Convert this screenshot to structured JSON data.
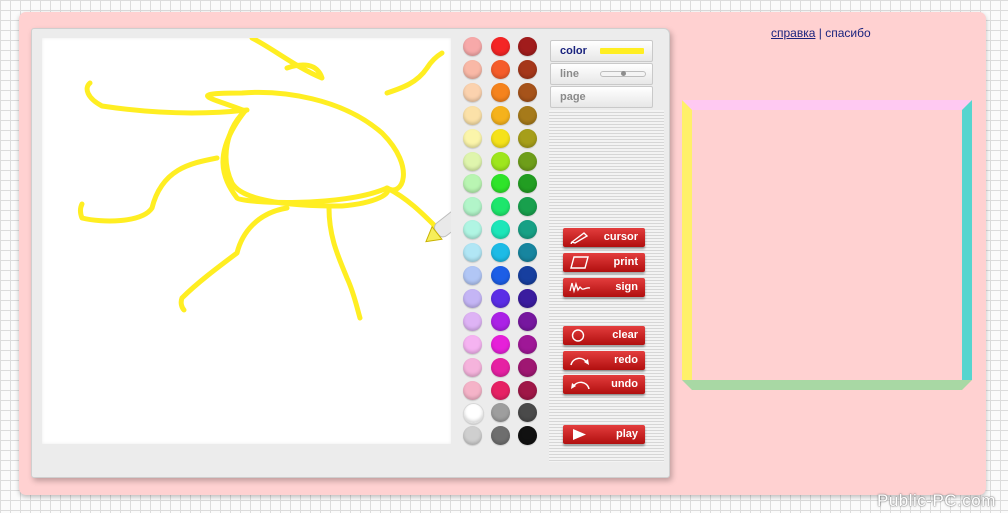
{
  "header_links": {
    "help": "справка",
    "separator": "|",
    "thanks": "спасибо"
  },
  "tool_tabs": {
    "color_label": "color",
    "line_label": "line",
    "page_label": "page",
    "current_color": "#ffee22"
  },
  "buttons": {
    "cursor": "cursor",
    "print": "print",
    "sign": "sign",
    "clear": "clear",
    "redo": "redo",
    "undo": "undo",
    "play": "play"
  },
  "palette": [
    [
      "#f7a9a9",
      "#f42525",
      "#a11c1c"
    ],
    [
      "#f9b8a6",
      "#f55c2a",
      "#a5371a"
    ],
    [
      "#fbd2ae",
      "#f5831d",
      "#a6531a"
    ],
    [
      "#fbe1a8",
      "#f5b21c",
      "#a67a1a"
    ],
    [
      "#fbf5aa",
      "#f5e21b",
      "#a69e1a"
    ],
    [
      "#dff5ad",
      "#9ee61d",
      "#6e9e1a"
    ],
    [
      "#b9f5b2",
      "#2fe42a",
      "#229e22"
    ],
    [
      "#b2f5c9",
      "#1ee66c",
      "#18a04d"
    ],
    [
      "#b0f5e3",
      "#1de6b9",
      "#17a085"
    ],
    [
      "#b1e6f5",
      "#1dbbe6",
      "#17859f"
    ],
    [
      "#b1c6f5",
      "#1d5ee6",
      "#173f9f"
    ],
    [
      "#c4b5f5",
      "#5b2ee6",
      "#3a1c9f"
    ],
    [
      "#deb3f5",
      "#ab21e6",
      "#76179f"
    ],
    [
      "#f5b3f1",
      "#e621d9",
      "#9f1797"
    ],
    [
      "#f5b3dc",
      "#e621a3",
      "#9f1772"
    ],
    [
      "#f5b3c8",
      "#e62164",
      "#9f1747"
    ],
    [
      "#ffffff",
      "#9e9e9e",
      "#4a4a4a"
    ],
    [
      "#cfcfcf",
      "#6e6e6e",
      "#111111"
    ]
  ],
  "preview_frame_colors": {
    "top": "#ffc9f2",
    "left": "#fff06a",
    "right": "#57d5cf",
    "bottom": "#a8d8a4",
    "fill": "#ffd1d1"
  },
  "watermark": "Public-PC.com"
}
